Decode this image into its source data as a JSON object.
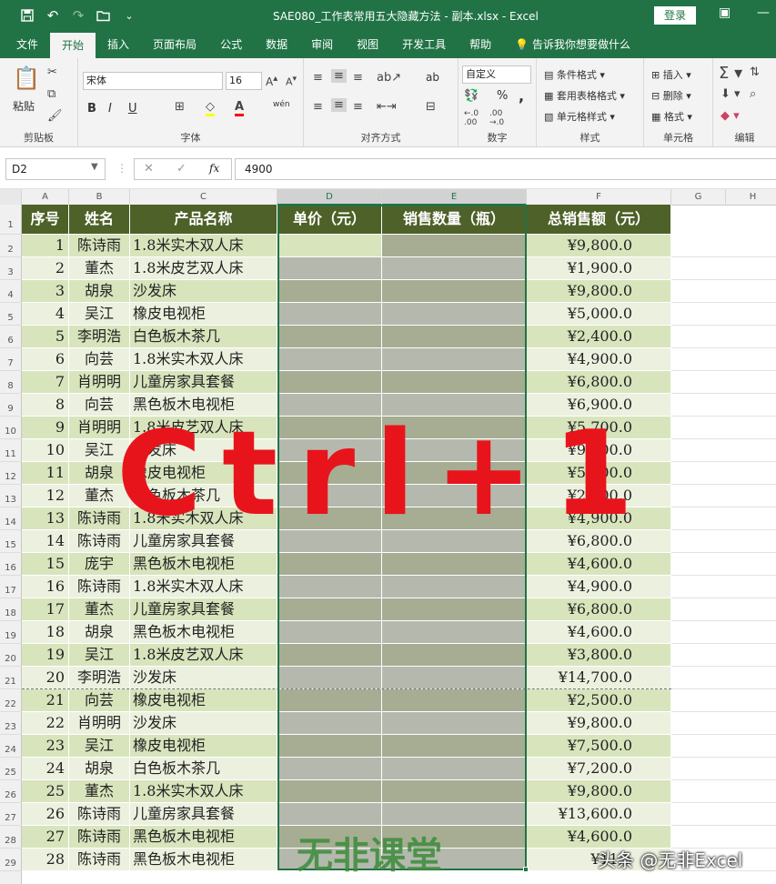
{
  "window": {
    "title": "SAE080_工作表常用五大隐藏方法 - 副本.xlsx  -  Excel",
    "login": "登录"
  },
  "menu": [
    "文件",
    "开始",
    "插入",
    "页面布局",
    "公式",
    "数据",
    "审阅",
    "视图",
    "开发工具",
    "帮助",
    "告诉我你想要做什么"
  ],
  "ribbon": {
    "clipboard": {
      "label": "剪贴板",
      "paste": "粘贴"
    },
    "font": {
      "label": "字体",
      "name": "宋体",
      "size": "16",
      "bold": "B",
      "italic": "I",
      "underline": "U",
      "phonetic": "wén"
    },
    "alignment": {
      "label": "对齐方式",
      "wrap": "ab"
    },
    "number": {
      "label": "数字",
      "format": "自定义",
      "percent": "%",
      "comma": ","
    },
    "styles": {
      "label": "样式",
      "conditional": "条件格式",
      "table": "套用表格格式",
      "cell": "单元格样式"
    },
    "cells": {
      "label": "单元格",
      "insert": "插入",
      "delete": "删除",
      "format": "格式"
    },
    "editing": {
      "label": "编辑"
    }
  },
  "formula_bar": {
    "name_box": "D2",
    "value": "4900",
    "fx": "fx"
  },
  "columns": [
    "A",
    "B",
    "C",
    "D",
    "E",
    "F",
    "G",
    "H"
  ],
  "headers": [
    "序号",
    "姓名",
    "产品名称",
    "单价（元）",
    "销售数量（瓶）",
    "总销售额（元）"
  ],
  "rows": [
    [
      "1",
      "陈诗雨",
      "1.8米实木双人床",
      "¥9,800.0"
    ],
    [
      "2",
      "董杰",
      "1.8米皮艺双人床",
      "¥1,900.0"
    ],
    [
      "3",
      "胡泉",
      "沙发床",
      "¥9,800.0"
    ],
    [
      "4",
      "吴江",
      "橡皮电视柜",
      "¥5,000.0"
    ],
    [
      "5",
      "李明浩",
      "白色板木茶几",
      "¥2,400.0"
    ],
    [
      "6",
      "向芸",
      "1.8米实木双人床",
      "¥4,900.0"
    ],
    [
      "7",
      "肖明明",
      "儿童房家具套餐",
      "¥6,800.0"
    ],
    [
      "8",
      "向芸",
      "黑色板木电视柜",
      "¥6,900.0"
    ],
    [
      "9",
      "肖明明",
      "1.8米皮艺双人床",
      "¥5,700.0"
    ],
    [
      "10",
      "吴江",
      "沙发床",
      "¥9,800.0"
    ],
    [
      "11",
      "胡泉",
      "橡皮电视柜",
      "¥5,000.0"
    ],
    [
      "12",
      "董杰",
      "白色板木茶几",
      "¥2,800.0"
    ],
    [
      "13",
      "陈诗雨",
      "1.8米实木双人床",
      "¥4,900.0"
    ],
    [
      "14",
      "陈诗雨",
      "儿童房家具套餐",
      "¥6,800.0"
    ],
    [
      "15",
      "庞宇",
      "黑色板木电视柜",
      "¥4,600.0"
    ],
    [
      "16",
      "陈诗雨",
      "1.8米实木双人床",
      "¥4,900.0"
    ],
    [
      "17",
      "董杰",
      "儿童房家具套餐",
      "¥6,800.0"
    ],
    [
      "18",
      "胡泉",
      "黑色板木电视柜",
      "¥4,600.0"
    ],
    [
      "19",
      "吴江",
      "1.8米皮艺双人床",
      "¥3,800.0"
    ],
    [
      "20",
      "李明浩",
      "沙发床",
      "¥14,700.0"
    ],
    [
      "21",
      "向芸",
      "橡皮电视柜",
      "¥2,500.0"
    ],
    [
      "22",
      "肖明明",
      "沙发床",
      "¥9,800.0"
    ],
    [
      "23",
      "吴江",
      "橡皮电视柜",
      "¥7,500.0"
    ],
    [
      "24",
      "胡泉",
      "白色板木茶几",
      "¥7,200.0"
    ],
    [
      "25",
      "董杰",
      "1.8米实木双人床",
      "¥9,800.0"
    ],
    [
      "26",
      "陈诗雨",
      "儿童房家具套餐",
      "¥13,600.0"
    ],
    [
      "27",
      "陈诗雨",
      "黑色板木电视柜",
      "¥4,600.0"
    ],
    [
      "28",
      "陈诗雨",
      "黑色板木电视柜",
      "¥11,5"
    ]
  ],
  "overlay_text": "Ctrl+1",
  "watermark": "无非课堂",
  "watermark2": "头条 @无非Excel",
  "colors": {
    "header_bg": "#4e6128",
    "row_light": "#d8e4bc",
    "row_pale": "#ebf1de",
    "excel_green": "#217346",
    "overlay": "#e8141c"
  }
}
